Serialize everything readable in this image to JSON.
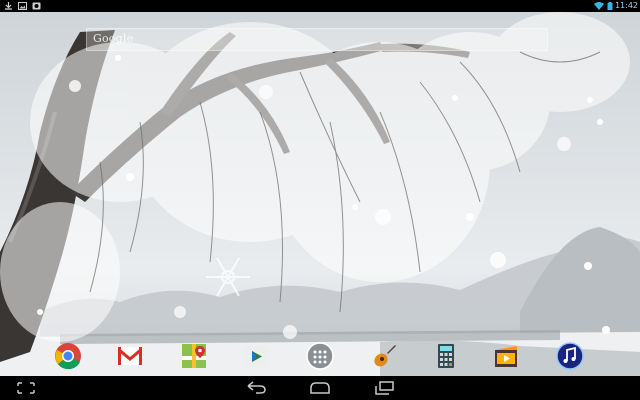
{
  "status_bar": {
    "time": "11:42",
    "left_icons": [
      "download-icon",
      "image-icon",
      "photo-icon"
    ],
    "right_icons": [
      "wifi-icon",
      "battery-icon"
    ],
    "time_color": "#9ec9e8"
  },
  "search": {
    "logo_text": "Google"
  },
  "dock": {
    "apps": [
      {
        "name": "chrome-icon"
      },
      {
        "name": "gmail-icon"
      },
      {
        "name": "maps-icon"
      },
      {
        "name": "play-store-icon"
      },
      {
        "name": "app-drawer-icon"
      },
      {
        "name": "guitar-icon"
      },
      {
        "name": "calculator-icon"
      },
      {
        "name": "movie-studio-icon"
      },
      {
        "name": "music-icon"
      }
    ]
  },
  "nav_bar": {
    "buttons": [
      "recent-apps-icon",
      "back-icon",
      "home-icon",
      "recents-icon"
    ]
  }
}
